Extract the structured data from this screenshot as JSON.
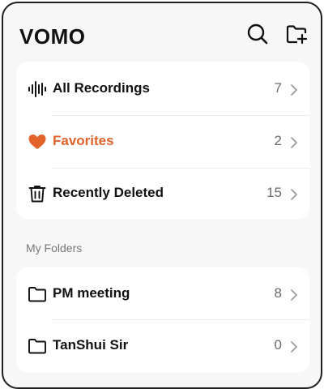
{
  "header": {
    "app_title": "VOMO",
    "search_icon": "search-icon",
    "new_folder_icon": "folder-add-icon"
  },
  "library": [
    {
      "label": "All Recordings",
      "count": "7",
      "icon": "waveform-icon",
      "accent": "#111111"
    },
    {
      "label": "Favorites",
      "count": "2",
      "icon": "heart-icon",
      "accent": "#e2632a"
    },
    {
      "label": "Recently Deleted",
      "count": "15",
      "icon": "trash-icon",
      "accent": "#111111"
    }
  ],
  "folders_section_label": "My Folders",
  "folders": [
    {
      "label": "PM meeting",
      "count": "8",
      "icon": "folder-icon"
    },
    {
      "label": "TanShui Sir",
      "count": "0",
      "icon": "folder-icon"
    }
  ],
  "colors": {
    "accent": "#e2632a",
    "background": "#f7f7f7",
    "card": "#ffffff",
    "text": "#111111",
    "muted": "#6b6b6b"
  }
}
